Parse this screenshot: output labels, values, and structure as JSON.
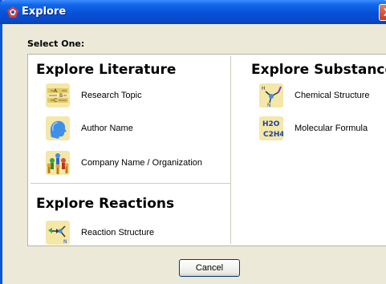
{
  "window": {
    "title": "Explore",
    "close_glyph": "X"
  },
  "prompt": "Select One:",
  "sections": {
    "literature": {
      "title": "Explore Literature",
      "options": [
        {
          "label": "Research Topic",
          "icon": "research-topic-icon"
        },
        {
          "label": "Author Name",
          "icon": "author-head-icon"
        },
        {
          "label": "Company Name / Organization",
          "icon": "people-group-icon"
        }
      ]
    },
    "substances": {
      "title": "Explore Substances",
      "options": [
        {
          "label": "Chemical Structure",
          "icon": "chemical-structure-icon"
        },
        {
          "label": "Molecular Formula",
          "icon": "molecular-formula-icon",
          "glyph_top": "H2O",
          "glyph_bottom": "C2H4"
        }
      ]
    },
    "reactions": {
      "title": "Explore Reactions",
      "options": [
        {
          "label": "Reaction Structure",
          "icon": "reaction-structure-icon"
        }
      ]
    }
  },
  "buttons": {
    "cancel": "Cancel"
  },
  "colors": {
    "titlebar": "#0A57D6",
    "dialog_bg": "#ECE9D8",
    "panel_bg": "#FFFFFF",
    "close_button": "#D0522E"
  }
}
